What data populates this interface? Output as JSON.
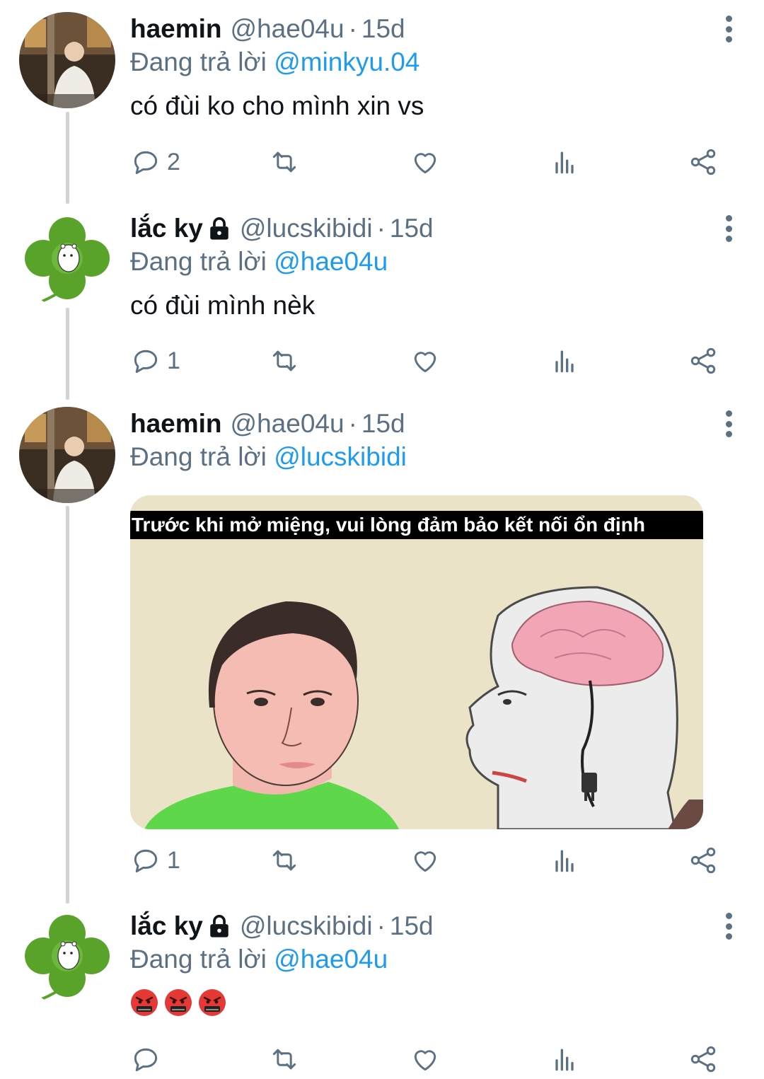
{
  "tweets": [
    {
      "display_name": "haemin",
      "handle": "@hae04u",
      "separator": "·",
      "time": "15d",
      "replying_prefix": "Đang trả lời",
      "replying_to": "@minkyu.04",
      "text": "có đùi ko cho mình xin vs",
      "reply_count": "2"
    },
    {
      "display_name": "lắc ky",
      "handle": "@lucskibidi",
      "separator": "·",
      "time": "15d",
      "replying_prefix": "Đang trả lời",
      "replying_to": "@hae04u",
      "text": "có đùi mình nèk",
      "reply_count": "1"
    },
    {
      "display_name": "haemin",
      "handle": "@hae04u",
      "separator": "·",
      "time": "15d",
      "replying_prefix": "Đang trả lời",
      "replying_to": "@lucskibidi",
      "media_caption": "Trước khi mở miệng, vui lòng đảm bảo kết nối ổn định",
      "reply_count": "1"
    },
    {
      "display_name": "lắc ky",
      "handle": "@lucskibidi",
      "separator": "·",
      "time": "15d",
      "replying_prefix": "Đang trả lời",
      "replying_to": "@hae04u",
      "emoji_text": "🤬🤬🤬",
      "reply_count": ""
    }
  ],
  "icons": {
    "reply": "reply-icon",
    "retweet": "retweet-icon",
    "like": "heart-icon",
    "views": "analytics-icon",
    "share": "share-icon",
    "more": "more-vertical-icon",
    "lock": "lock-icon"
  },
  "colors": {
    "mention": "#1d9bf0",
    "secondary_text": "#5b7083",
    "thread_line": "#d0d4d8"
  }
}
